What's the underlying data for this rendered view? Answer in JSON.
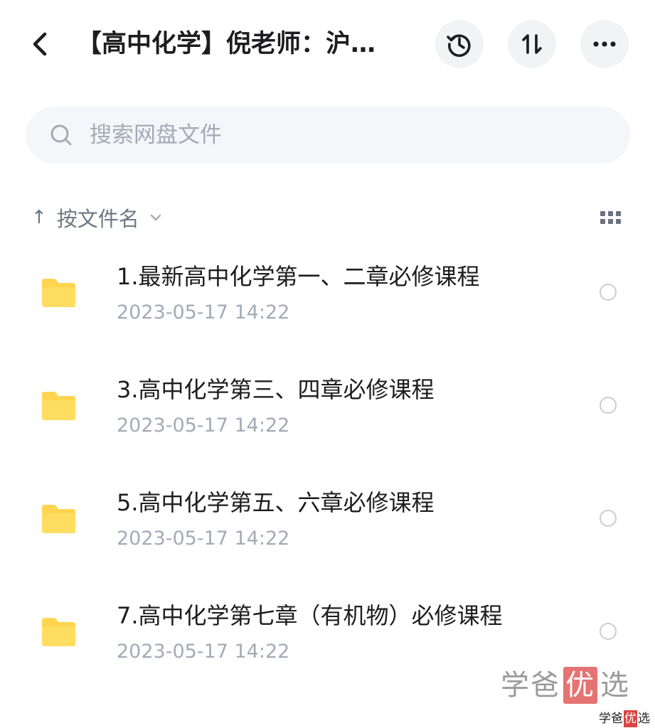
{
  "header": {
    "title": "【高中化学】倪老师：沪…",
    "back_icon": "chevron-left-icon",
    "history_icon": "history-clock-icon",
    "sort_icon": "sort-arrows-icon",
    "more_icon": "more-horizontal-icon"
  },
  "search": {
    "placeholder": "搜索网盘文件",
    "icon": "search-icon"
  },
  "sort": {
    "arrow": "↑",
    "label": "按文件名",
    "chevron_icon": "chevron-down-icon",
    "view_icon": "grid-view-icon"
  },
  "files": [
    {
      "name": "1.最新高中化学第一、二章必修课程",
      "date": "2023-05-17  14:22"
    },
    {
      "name": "3.高中化学第三、四章必修课程",
      "date": "2023-05-17  14:22"
    },
    {
      "name": "5.高中化学第五、六章必修课程",
      "date": "2023-05-17  14:22"
    },
    {
      "name": "7.高中化学第七章（有机物）必修课程",
      "date": "2023-05-17  14:22"
    }
  ],
  "watermark": {
    "large": {
      "part1": "学爸",
      "highlight": "优",
      "part2": "选"
    },
    "small": {
      "part1": "学爸",
      "highlight": "优",
      "part2": "选"
    }
  },
  "colors": {
    "folder": "#ffd54f",
    "watermark_highlight": "#e57373"
  }
}
